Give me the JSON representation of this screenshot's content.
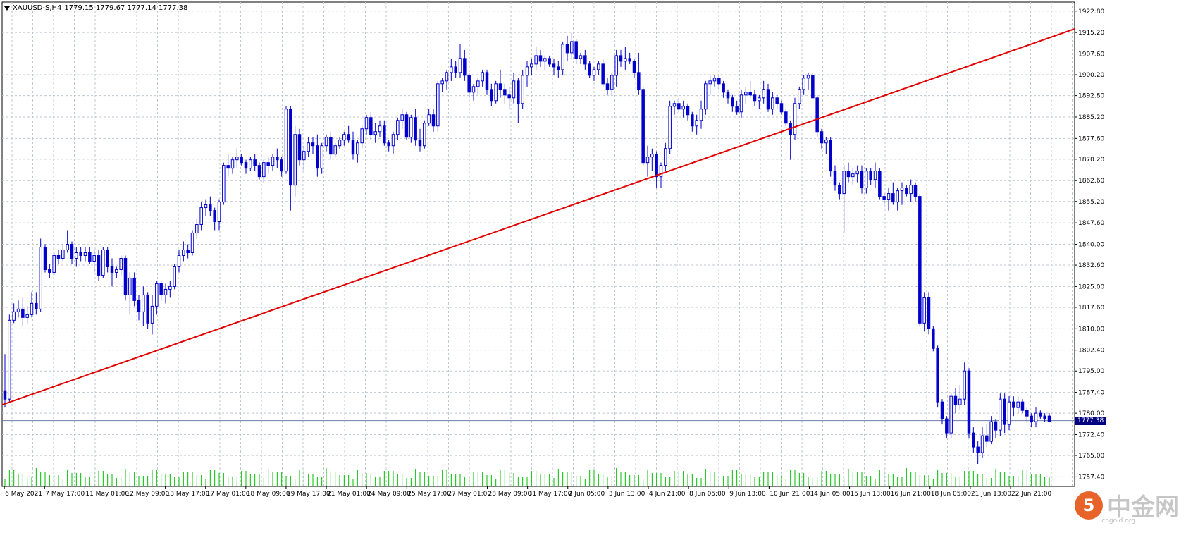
{
  "header": {
    "symbol": "XAUUSD-S,H4",
    "ohlc": "1779.15 1779.67 1777.14 1777.38"
  },
  "current_price_label": "1777.38",
  "watermark": {
    "logo_text": "5",
    "brand": "中金网",
    "sub": "cngold.org"
  },
  "colors": {
    "candle": "#0000cd",
    "trendline": "#e00000",
    "grid": "#bfc7d1",
    "volume": "#00c000",
    "price_line": "#6b7fa8",
    "axis_text": "#000000"
  },
  "chart_data": {
    "type": "candlestick",
    "y_axis_labels": [
      "1922.80",
      "1915.20",
      "1907.60",
      "1900.20",
      "1892.80",
      "1885.20",
      "1877.60",
      "1870.20",
      "1862.60",
      "1855.20",
      "1847.60",
      "1840.00",
      "1832.60",
      "1825.00",
      "1817.60",
      "1810.00",
      "1802.40",
      "1795.00",
      "1787.40",
      "1780.00",
      "1772.40",
      "1765.00",
      "1757.40"
    ],
    "y_range": [
      1754.0,
      1926.0
    ],
    "x_axis_labels": [
      "6 May 2021",
      "7 May 17:00",
      "11 May 01:00",
      "12 May 09:00",
      "13 May 17:00",
      "17 May 01:00",
      "18 May 09:00",
      "19 May 17:00",
      "21 May 01:00",
      "24 May 09:00",
      "25 May 17:00",
      "27 May 01:00",
      "28 May 09:00",
      "31 May 17:00",
      "2 Jun 05:00",
      "3 Jun 13:00",
      "4 Jun 21:00",
      "8 Jun 05:00",
      "9 Jun 13:00",
      "10 Jun 21:00",
      "14 Jun 05:00",
      "15 Jun 13:00",
      "16 Jun 21:00",
      "18 Jun 05:00",
      "21 Jun 13:00",
      "22 Jun 21:00"
    ],
    "current_price": 1777.38,
    "trendline": {
      "start": {
        "bar": 0,
        "price": 1783.0
      },
      "end": {
        "bar": 255,
        "price": 1916.5
      }
    },
    "candles": [
      [
        1788,
        1801,
        1782,
        1785
      ],
      [
        1785,
        1815,
        1784,
        1813
      ],
      [
        1813,
        1819,
        1812,
        1816
      ],
      [
        1816,
        1820,
        1814,
        1817
      ],
      [
        1817,
        1821,
        1811,
        1814
      ],
      [
        1814,
        1818,
        1812,
        1815
      ],
      [
        1815,
        1823,
        1814,
        1819
      ],
      [
        1819,
        1823,
        1815,
        1817
      ],
      [
        1817,
        1842,
        1816,
        1839
      ],
      [
        1839,
        1840,
        1830,
        1831
      ],
      [
        1831,
        1833,
        1828,
        1830
      ],
      [
        1830,
        1837,
        1829,
        1836
      ],
      [
        1836,
        1838,
        1833,
        1835
      ],
      [
        1835,
        1840,
        1834,
        1838
      ],
      [
        1838,
        1845,
        1837,
        1840
      ],
      [
        1840,
        1841,
        1833,
        1835
      ],
      [
        1835,
        1839,
        1832,
        1837
      ],
      [
        1837,
        1839,
        1834,
        1836
      ],
      [
        1836,
        1839,
        1834,
        1837
      ],
      [
        1837,
        1839,
        1833,
        1834
      ],
      [
        1834,
        1838,
        1830,
        1836
      ],
      [
        1836,
        1838,
        1827,
        1829
      ],
      [
        1829,
        1839,
        1828,
        1838
      ],
      [
        1838,
        1839,
        1830,
        1832
      ],
      [
        1832,
        1835,
        1825,
        1830
      ],
      [
        1830,
        1832,
        1828,
        1831
      ],
      [
        1831,
        1836,
        1829,
        1835
      ],
      [
        1835,
        1836,
        1820,
        1822
      ],
      [
        1822,
        1830,
        1815,
        1828
      ],
      [
        1828,
        1830,
        1818,
        1820
      ],
      [
        1820,
        1822,
        1813,
        1816
      ],
      [
        1816,
        1825,
        1811,
        1822
      ],
      [
        1822,
        1823,
        1810,
        1812
      ],
      [
        1812,
        1822,
        1808,
        1818
      ],
      [
        1818,
        1827,
        1815,
        1826
      ],
      [
        1826,
        1827,
        1820,
        1822
      ],
      [
        1822,
        1826,
        1819,
        1824
      ],
      [
        1824,
        1827,
        1821,
        1825
      ],
      [
        1825,
        1833,
        1824,
        1832
      ],
      [
        1832,
        1838,
        1830,
        1836
      ],
      [
        1836,
        1841,
        1834,
        1838
      ],
      [
        1838,
        1840,
        1835,
        1837
      ],
      [
        1837,
        1845,
        1836,
        1844
      ],
      [
        1844,
        1849,
        1842,
        1847
      ],
      [
        1847,
        1855,
        1845,
        1853
      ],
      [
        1853,
        1856,
        1850,
        1854
      ],
      [
        1854,
        1857,
        1850,
        1852
      ],
      [
        1852,
        1853,
        1845,
        1848
      ],
      [
        1848,
        1856,
        1845,
        1855
      ],
      [
        1855,
        1869,
        1854,
        1868
      ],
      [
        1868,
        1872,
        1864,
        1867
      ],
      [
        1867,
        1871,
        1865,
        1870
      ],
      [
        1870,
        1874,
        1867,
        1871
      ],
      [
        1871,
        1872,
        1868,
        1869
      ],
      [
        1869,
        1870,
        1865,
        1867
      ],
      [
        1867,
        1871,
        1866,
        1870
      ],
      [
        1870,
        1872,
        1866,
        1868
      ],
      [
        1868,
        1869,
        1863,
        1864
      ],
      [
        1864,
        1870,
        1862,
        1869
      ],
      [
        1869,
        1871,
        1865,
        1868
      ],
      [
        1868,
        1872,
        1866,
        1871
      ],
      [
        1871,
        1874,
        1867,
        1870
      ],
      [
        1870,
        1871,
        1864,
        1866
      ],
      [
        1866,
        1889,
        1865,
        1888
      ],
      [
        1888,
        1889,
        1852,
        1861
      ],
      [
        1861,
        1882,
        1857,
        1879
      ],
      [
        1879,
        1881,
        1868,
        1870
      ],
      [
        1870,
        1875,
        1866,
        1873
      ],
      [
        1873,
        1878,
        1871,
        1876
      ],
      [
        1876,
        1878,
        1872,
        1875
      ],
      [
        1875,
        1879,
        1864,
        1867
      ],
      [
        1867,
        1876,
        1865,
        1875
      ],
      [
        1875,
        1879,
        1873,
        1878
      ],
      [
        1878,
        1880,
        1870,
        1872
      ],
      [
        1872,
        1876,
        1871,
        1875
      ],
      [
        1875,
        1878,
        1874,
        1877
      ],
      [
        1877,
        1880,
        1875,
        1879
      ],
      [
        1879,
        1882,
        1876,
        1877
      ],
      [
        1877,
        1880,
        1870,
        1872
      ],
      [
        1872,
        1877,
        1869,
        1876
      ],
      [
        1876,
        1882,
        1874,
        1881
      ],
      [
        1881,
        1886,
        1879,
        1885
      ],
      [
        1885,
        1887,
        1877,
        1879
      ],
      [
        1879,
        1883,
        1876,
        1880
      ],
      [
        1880,
        1884,
        1878,
        1882
      ],
      [
        1882,
        1884,
        1875,
        1876
      ],
      [
        1876,
        1877,
        1873,
        1875
      ],
      [
        1875,
        1880,
        1872,
        1879
      ],
      [
        1879,
        1885,
        1877,
        1884
      ],
      [
        1884,
        1888,
        1881,
        1886
      ],
      [
        1886,
        1887,
        1877,
        1878
      ],
      [
        1878,
        1886,
        1876,
        1885
      ],
      [
        1885,
        1888,
        1875,
        1877
      ],
      [
        1877,
        1881,
        1873,
        1875
      ],
      [
        1875,
        1884,
        1874,
        1883
      ],
      [
        1883,
        1888,
        1882,
        1886
      ],
      [
        1886,
        1888,
        1880,
        1882
      ],
      [
        1882,
        1898,
        1880,
        1897
      ],
      [
        1897,
        1899,
        1894,
        1898
      ],
      [
        1898,
        1902,
        1895,
        1901
      ],
      [
        1901,
        1906,
        1898,
        1903
      ],
      [
        1903,
        1905,
        1899,
        1901
      ],
      [
        1901,
        1911,
        1899,
        1906
      ],
      [
        1906,
        1909,
        1898,
        1900
      ],
      [
        1900,
        1901,
        1892,
        1894
      ],
      [
        1894,
        1897,
        1891,
        1896
      ],
      [
        1896,
        1899,
        1893,
        1898
      ],
      [
        1898,
        1902,
        1896,
        1901
      ],
      [
        1901,
        1902,
        1893,
        1895
      ],
      [
        1895,
        1897,
        1889,
        1891
      ],
      [
        1891,
        1898,
        1890,
        1897
      ],
      [
        1897,
        1902,
        1892,
        1895
      ],
      [
        1895,
        1897,
        1890,
        1893
      ],
      [
        1893,
        1896,
        1888,
        1892
      ],
      [
        1892,
        1901,
        1890,
        1898
      ],
      [
        1898,
        1899,
        1883,
        1890
      ],
      [
        1890,
        1902,
        1888,
        1900
      ],
      [
        1900,
        1905,
        1896,
        1903
      ],
      [
        1903,
        1906,
        1900,
        1904
      ],
      [
        1904,
        1910,
        1902,
        1907
      ],
      [
        1907,
        1909,
        1903,
        1905
      ],
      [
        1905,
        1907,
        1902,
        1906
      ],
      [
        1906,
        1907,
        1903,
        1904
      ],
      [
        1904,
        1906,
        1900,
        1903
      ],
      [
        1903,
        1905,
        1899,
        1902
      ],
      [
        1902,
        1912,
        1900,
        1911
      ],
      [
        1911,
        1914,
        1905,
        1908
      ],
      [
        1908,
        1915,
        1906,
        1912
      ],
      [
        1912,
        1913,
        1904,
        1906
      ],
      [
        1906,
        1908,
        1904,
        1907
      ],
      [
        1907,
        1909,
        1902,
        1904
      ],
      [
        1904,
        1905,
        1899,
        1900
      ],
      [
        1900,
        1903,
        1898,
        1902
      ],
      [
        1902,
        1905,
        1900,
        1904
      ],
      [
        1904,
        1906,
        1896,
        1897
      ],
      [
        1897,
        1899,
        1893,
        1895
      ],
      [
        1895,
        1901,
        1893,
        1900
      ],
      [
        1900,
        1909,
        1896,
        1907
      ],
      [
        1907,
        1909,
        1903,
        1905
      ],
      [
        1905,
        1910,
        1902,
        1906
      ],
      [
        1906,
        1908,
        1904,
        1905
      ],
      [
        1905,
        1906,
        1899,
        1901
      ],
      [
        1901,
        1908,
        1893,
        1895
      ],
      [
        1895,
        1896,
        1868,
        1869
      ],
      [
        1869,
        1875,
        1864,
        1871
      ],
      [
        1871,
        1874,
        1866,
        1872
      ],
      [
        1872,
        1873,
        1860,
        1864
      ],
      [
        1864,
        1869,
        1860,
        1868
      ],
      [
        1868,
        1876,
        1866,
        1874
      ],
      [
        1874,
        1891,
        1872,
        1889
      ],
      [
        1889,
        1891,
        1886,
        1890
      ],
      [
        1890,
        1892,
        1887,
        1888
      ],
      [
        1888,
        1891,
        1885,
        1889
      ],
      [
        1889,
        1890,
        1884,
        1886
      ],
      [
        1886,
        1887,
        1880,
        1882
      ],
      [
        1882,
        1886,
        1879,
        1884
      ],
      [
        1884,
        1891,
        1881,
        1888
      ],
      [
        1888,
        1898,
        1886,
        1897
      ],
      [
        1897,
        1900,
        1893,
        1898
      ],
      [
        1898,
        1900,
        1896,
        1899
      ],
      [
        1899,
        1900,
        1895,
        1897
      ],
      [
        1897,
        1898,
        1892,
        1894
      ],
      [
        1894,
        1895,
        1890,
        1892
      ],
      [
        1892,
        1893,
        1887,
        1889
      ],
      [
        1889,
        1891,
        1886,
        1887
      ],
      [
        1887,
        1895,
        1885,
        1893
      ],
      [
        1893,
        1896,
        1890,
        1894
      ],
      [
        1894,
        1898,
        1892,
        1893
      ],
      [
        1893,
        1895,
        1889,
        1891
      ],
      [
        1891,
        1893,
        1888,
        1892
      ],
      [
        1892,
        1898,
        1890,
        1895
      ],
      [
        1895,
        1897,
        1887,
        1888
      ],
      [
        1888,
        1894,
        1886,
        1892
      ],
      [
        1892,
        1893,
        1888,
        1890
      ],
      [
        1890,
        1891,
        1886,
        1887
      ],
      [
        1887,
        1888,
        1882,
        1883
      ],
      [
        1883,
        1884,
        1870,
        1879
      ],
      [
        1879,
        1892,
        1877,
        1890
      ],
      [
        1890,
        1896,
        1888,
        1895
      ],
      [
        1895,
        1900,
        1893,
        1899
      ],
      [
        1899,
        1901,
        1895,
        1900
      ],
      [
        1900,
        1901,
        1893,
        1892
      ],
      [
        1892,
        1893,
        1878,
        1880
      ],
      [
        1880,
        1881,
        1874,
        1876
      ],
      [
        1876,
        1878,
        1872,
        1877
      ],
      [
        1877,
        1878,
        1864,
        1866
      ],
      [
        1866,
        1868,
        1859,
        1861
      ],
      [
        1861,
        1862,
        1856,
        1858
      ],
      [
        1858,
        1868,
        1844,
        1866
      ],
      [
        1866,
        1869,
        1862,
        1864
      ],
      [
        1864,
        1867,
        1861,
        1865
      ],
      [
        1865,
        1868,
        1862,
        1866
      ],
      [
        1866,
        1868,
        1858,
        1860
      ],
      [
        1860,
        1867,
        1858,
        1866
      ],
      [
        1866,
        1867,
        1861,
        1863
      ],
      [
        1863,
        1869,
        1860,
        1866
      ],
      [
        1866,
        1867,
        1856,
        1857
      ],
      [
        1857,
        1858,
        1854,
        1856
      ],
      [
        1856,
        1860,
        1852,
        1858
      ],
      [
        1858,
        1862,
        1854,
        1855
      ],
      [
        1855,
        1860,
        1852,
        1859
      ],
      [
        1859,
        1862,
        1854,
        1860
      ],
      [
        1860,
        1861,
        1857,
        1858
      ],
      [
        1858,
        1863,
        1855,
        1861
      ],
      [
        1861,
        1862,
        1855,
        1857
      ],
      [
        1857,
        1858,
        1811,
        1812
      ],
      [
        1812,
        1823,
        1809,
        1821
      ],
      [
        1821,
        1823,
        1808,
        1810
      ],
      [
        1810,
        1811,
        1802,
        1803
      ],
      [
        1803,
        1804,
        1782,
        1784
      ],
      [
        1784,
        1785,
        1776,
        1778
      ],
      [
        1778,
        1779,
        1771,
        1773
      ],
      [
        1773,
        1787,
        1771,
        1786
      ],
      [
        1786,
        1789,
        1780,
        1783
      ],
      [
        1783,
        1790,
        1781,
        1785
      ],
      [
        1785,
        1798,
        1783,
        1795
      ],
      [
        1795,
        1796,
        1771,
        1773
      ],
      [
        1773,
        1775,
        1766,
        1768
      ],
      [
        1768,
        1770,
        1762,
        1766
      ],
      [
        1766,
        1775,
        1764,
        1772
      ],
      [
        1772,
        1776,
        1768,
        1770
      ],
      [
        1770,
        1779,
        1769,
        1777
      ],
      [
        1777,
        1778,
        1771,
        1774
      ],
      [
        1774,
        1787,
        1772,
        1785
      ],
      [
        1785,
        1787,
        1773,
        1776
      ],
      [
        1776,
        1786,
        1774,
        1784
      ],
      [
        1784,
        1786,
        1779,
        1782
      ],
      [
        1782,
        1786,
        1780,
        1784
      ],
      [
        1784,
        1785,
        1780,
        1781
      ],
      [
        1781,
        1782,
        1777,
        1779
      ],
      [
        1779,
        1780,
        1775,
        1777
      ],
      [
        1777,
        1782,
        1775,
        1780
      ],
      [
        1780,
        1781,
        1778,
        1779
      ],
      [
        1779,
        1780,
        1777,
        1778
      ],
      [
        1779,
        1780,
        1777,
        1777
      ]
    ]
  }
}
